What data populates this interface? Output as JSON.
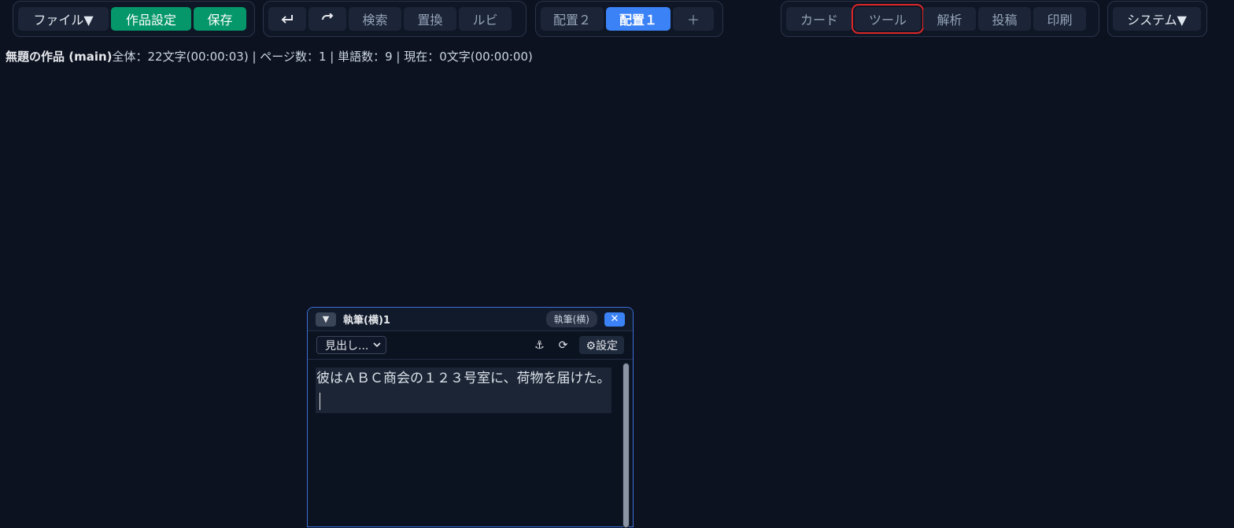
{
  "toolbar": {
    "file_menu": "ファイル▼",
    "work_settings": "作品設定",
    "save": "保存",
    "undo_icon": "undo-icon",
    "redo_icon": "redo-icon",
    "search": "検索",
    "replace": "置換",
    "ruby": "ルビ",
    "layout2": "配置２",
    "layout1": "配置１",
    "add": "＋",
    "card": "カード",
    "tool": "ツール",
    "analysis": "解析",
    "post": "投稿",
    "print": "印刷",
    "system_menu": "システム▼"
  },
  "status": {
    "title": "無題の作品 (main)",
    "details": "全体：22文字(00:00:03) | ページ数：1 | 単語数：9 | 現在：0文字(00:00:00)"
  },
  "panel": {
    "title": "執筆(横)1",
    "tag": "執筆(横)",
    "close": "✕",
    "collapse": "▼",
    "heading_select": "見出し...",
    "anchor": "⚓",
    "refresh": "⟳",
    "settings": "⚙設定",
    "text": "彼はＡＢＣ商会の１２３号室に、荷物を届けた。"
  },
  "colors": {
    "background": "#0c1220",
    "accent": "#3b82f6",
    "green": "#059669",
    "highlight": "#dc2626"
  }
}
